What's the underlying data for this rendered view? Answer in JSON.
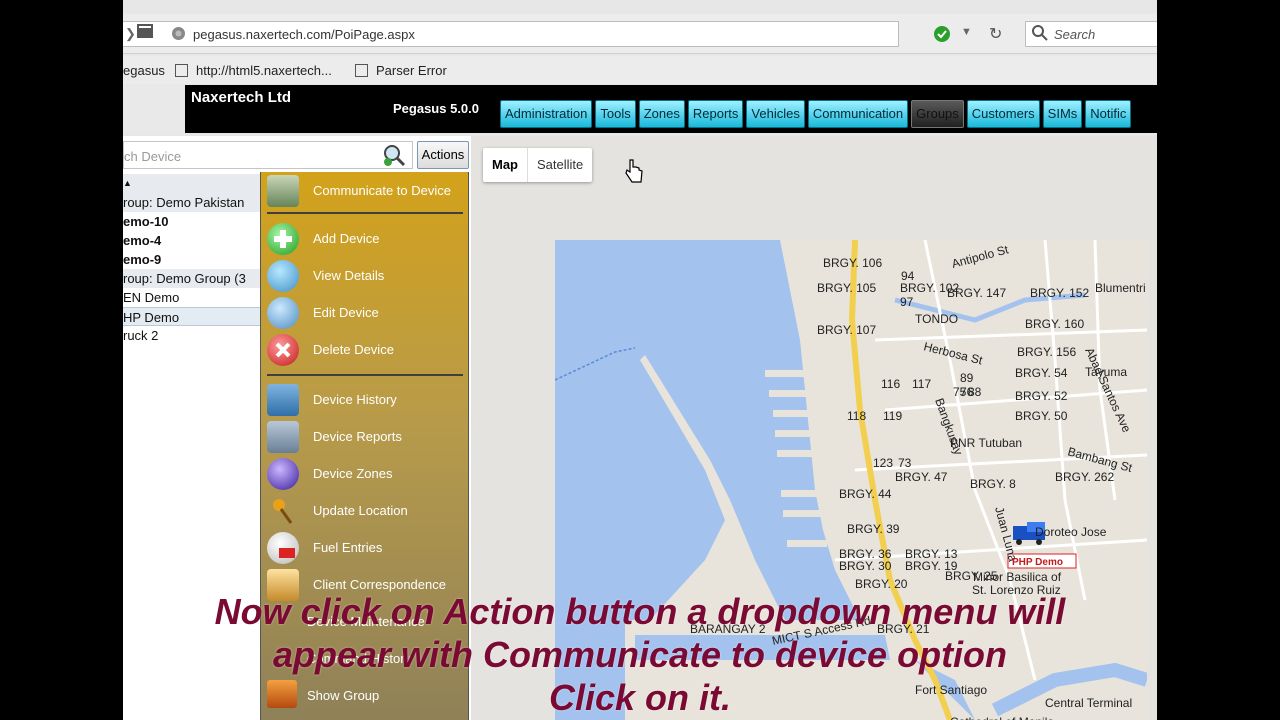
{
  "browser": {
    "url": "pegasus.naxertech.com/PoiPage.aspx",
    "search_placeholder": "Search",
    "bookmarks": [
      "egasus",
      "http://html5.naxertech...",
      "Parser Error"
    ]
  },
  "header": {
    "company": "Naxertech Ltd",
    "version": "Pegasus 5.0.0",
    "nav": [
      {
        "label": "Administration"
      },
      {
        "label": "Tools"
      },
      {
        "label": "Zones"
      },
      {
        "label": "Reports"
      },
      {
        "label": "Vehicles"
      },
      {
        "label": "Communication"
      },
      {
        "label": "Groups",
        "active": true
      },
      {
        "label": "Customers"
      },
      {
        "label": "SIMs"
      },
      {
        "label": "Notific"
      }
    ]
  },
  "sidebar": {
    "search_placeholder": "ch Device",
    "actions_label": "Actions",
    "tree": [
      {
        "label": "▲",
        "type": "header"
      },
      {
        "label": "roup: Demo Pakistan",
        "type": "group"
      },
      {
        "label": "emo-10",
        "type": "device",
        "bold": true
      },
      {
        "label": "emo-4",
        "type": "device",
        "bold": true
      },
      {
        "label": "emo-9",
        "type": "device",
        "bold": true
      },
      {
        "label": "roup: Demo Group (3",
        "type": "group"
      },
      {
        "label": "EN Demo",
        "type": "device"
      },
      {
        "label": "HP Demo",
        "type": "device",
        "selected": true
      },
      {
        "label": "ruck 2",
        "type": "device"
      }
    ]
  },
  "actions_menu": {
    "items": [
      {
        "label": "Communicate to Device",
        "icon": "communicate-icon"
      },
      {
        "label": "Add Device",
        "icon": "add-icon"
      },
      {
        "label": "View Details",
        "icon": "details-icon"
      },
      {
        "label": "Edit Device",
        "icon": "edit-icon"
      },
      {
        "label": "Delete Device",
        "icon": "delete-icon"
      },
      {
        "label": "Device History",
        "icon": "history-icon"
      },
      {
        "label": "Device Reports",
        "icon": "reports-icon"
      },
      {
        "label": "Device Zones",
        "icon": "zones-icon"
      },
      {
        "label": "Update Location",
        "icon": "location-pin-icon"
      },
      {
        "label": "Fuel Entries",
        "icon": "fuel-icon"
      },
      {
        "label": "Client Correspondence",
        "icon": "correspondence-icon"
      },
      {
        "label": "Device Maintenance",
        "icon": "maintenance-icon"
      },
      {
        "label": "Command History",
        "icon": "command-history-icon"
      },
      {
        "label": "Show Group",
        "icon": "show-group-icon"
      }
    ]
  },
  "map": {
    "type_buttons": [
      "Map",
      "Satellite"
    ],
    "labels": [
      "Antipolo St",
      "Blumentri",
      "BRGY. 106",
      "94",
      "BRGY. 105",
      "BRGY. 102",
      "BRGY. 147",
      "BRGY. 152",
      "97",
      "TONDO",
      "BRGY. 107",
      "BRGY. 160",
      "Herbosa St",
      "BRGY. 156",
      "Abad Santos Ave",
      "116",
      "117",
      "89",
      "BRGY. 54",
      "Tayuma",
      "Bangkusay",
      "76",
      "88",
      "75",
      "BRGY. 52",
      "118",
      "119",
      "BRGY. 50",
      "PNR Tutuban",
      "Bambang St",
      "123",
      "73",
      "BRGY. 47",
      "BRGY. 262",
      "BRGY. 44",
      "BRGY. 8",
      "Juan Luna",
      "BRGY. 39",
      "Doroteo Jose",
      "BRGY. 36",
      "BRGY. 13",
      "BRGY. 30",
      "BRGY. 19",
      "BRGY. 20",
      "BRGY. 25",
      "Minor Basilica of",
      "St. Lorenzo Ruiz",
      "BARANGAY 2",
      "MICT S Access Rd",
      "BRGY. 21",
      "Fort Santiago",
      "Central Terminal",
      "Cathedral of Manila"
    ],
    "marker_label": "PHP Demo",
    "colors": {
      "water": "#a3c2ee",
      "land": "#e8e4db",
      "highway": "#f2cf4e"
    }
  },
  "caption": {
    "lines": [
      "Now click on Action button a dropdown menu will",
      "appear with Communicate to device option",
      "Click on it."
    ],
    "color": "#7a0a33"
  }
}
